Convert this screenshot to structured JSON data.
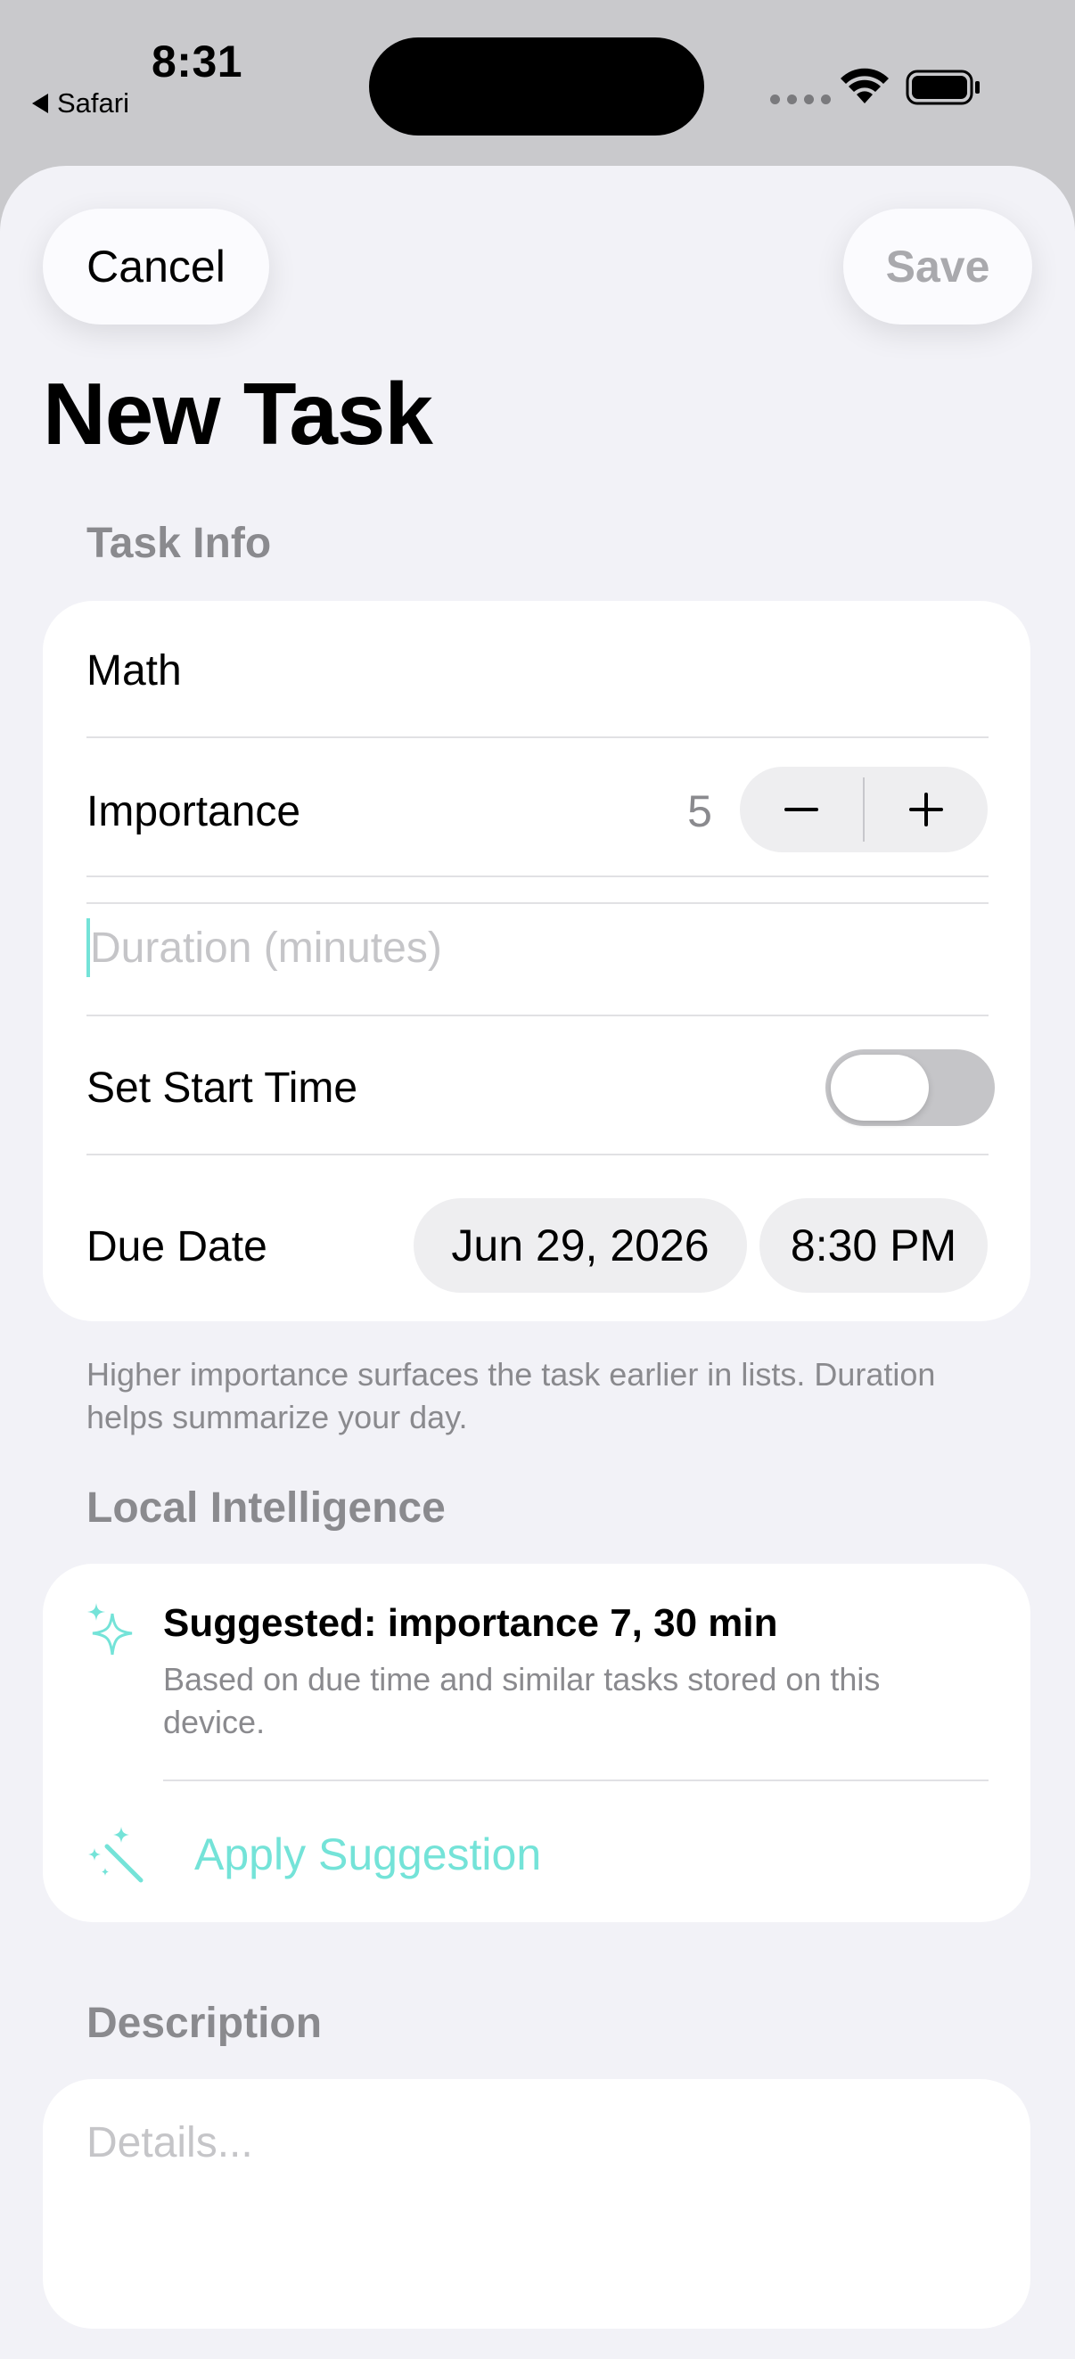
{
  "status_bar": {
    "time": "8:31",
    "back_app": "Safari"
  },
  "nav": {
    "cancel_label": "Cancel",
    "save_label": "Save",
    "title": "New Task"
  },
  "task_info": {
    "header": "Task Info",
    "name_value": "Math",
    "importance_label": "Importance",
    "importance_value": "5",
    "duration_placeholder": "Duration (minutes)",
    "start_time_label": "Set Start Time",
    "start_time_enabled": false,
    "due_date_label": "Due Date",
    "due_date_value": "Jun 29, 2026",
    "due_time_value": "8:30 PM",
    "footer": "Higher importance surfaces the task earlier in lists. Duration helps summarize your day."
  },
  "local_intelligence": {
    "header": "Local Intelligence",
    "suggestion_title": "Suggested: importance 7, 30 min",
    "suggestion_detail": "Based on due time and similar tasks stored on this device.",
    "apply_label": "Apply Suggestion"
  },
  "description": {
    "header": "Description",
    "placeholder": "Details..."
  },
  "colors": {
    "accent": "#74e3d8",
    "background": "#f2f2f7",
    "secondary_text": "#8a8a8e"
  },
  "icons": [
    "sparkles-icon",
    "magic-wand-icon",
    "minus-icon",
    "plus-icon",
    "wifi-icon",
    "battery-icon"
  ]
}
